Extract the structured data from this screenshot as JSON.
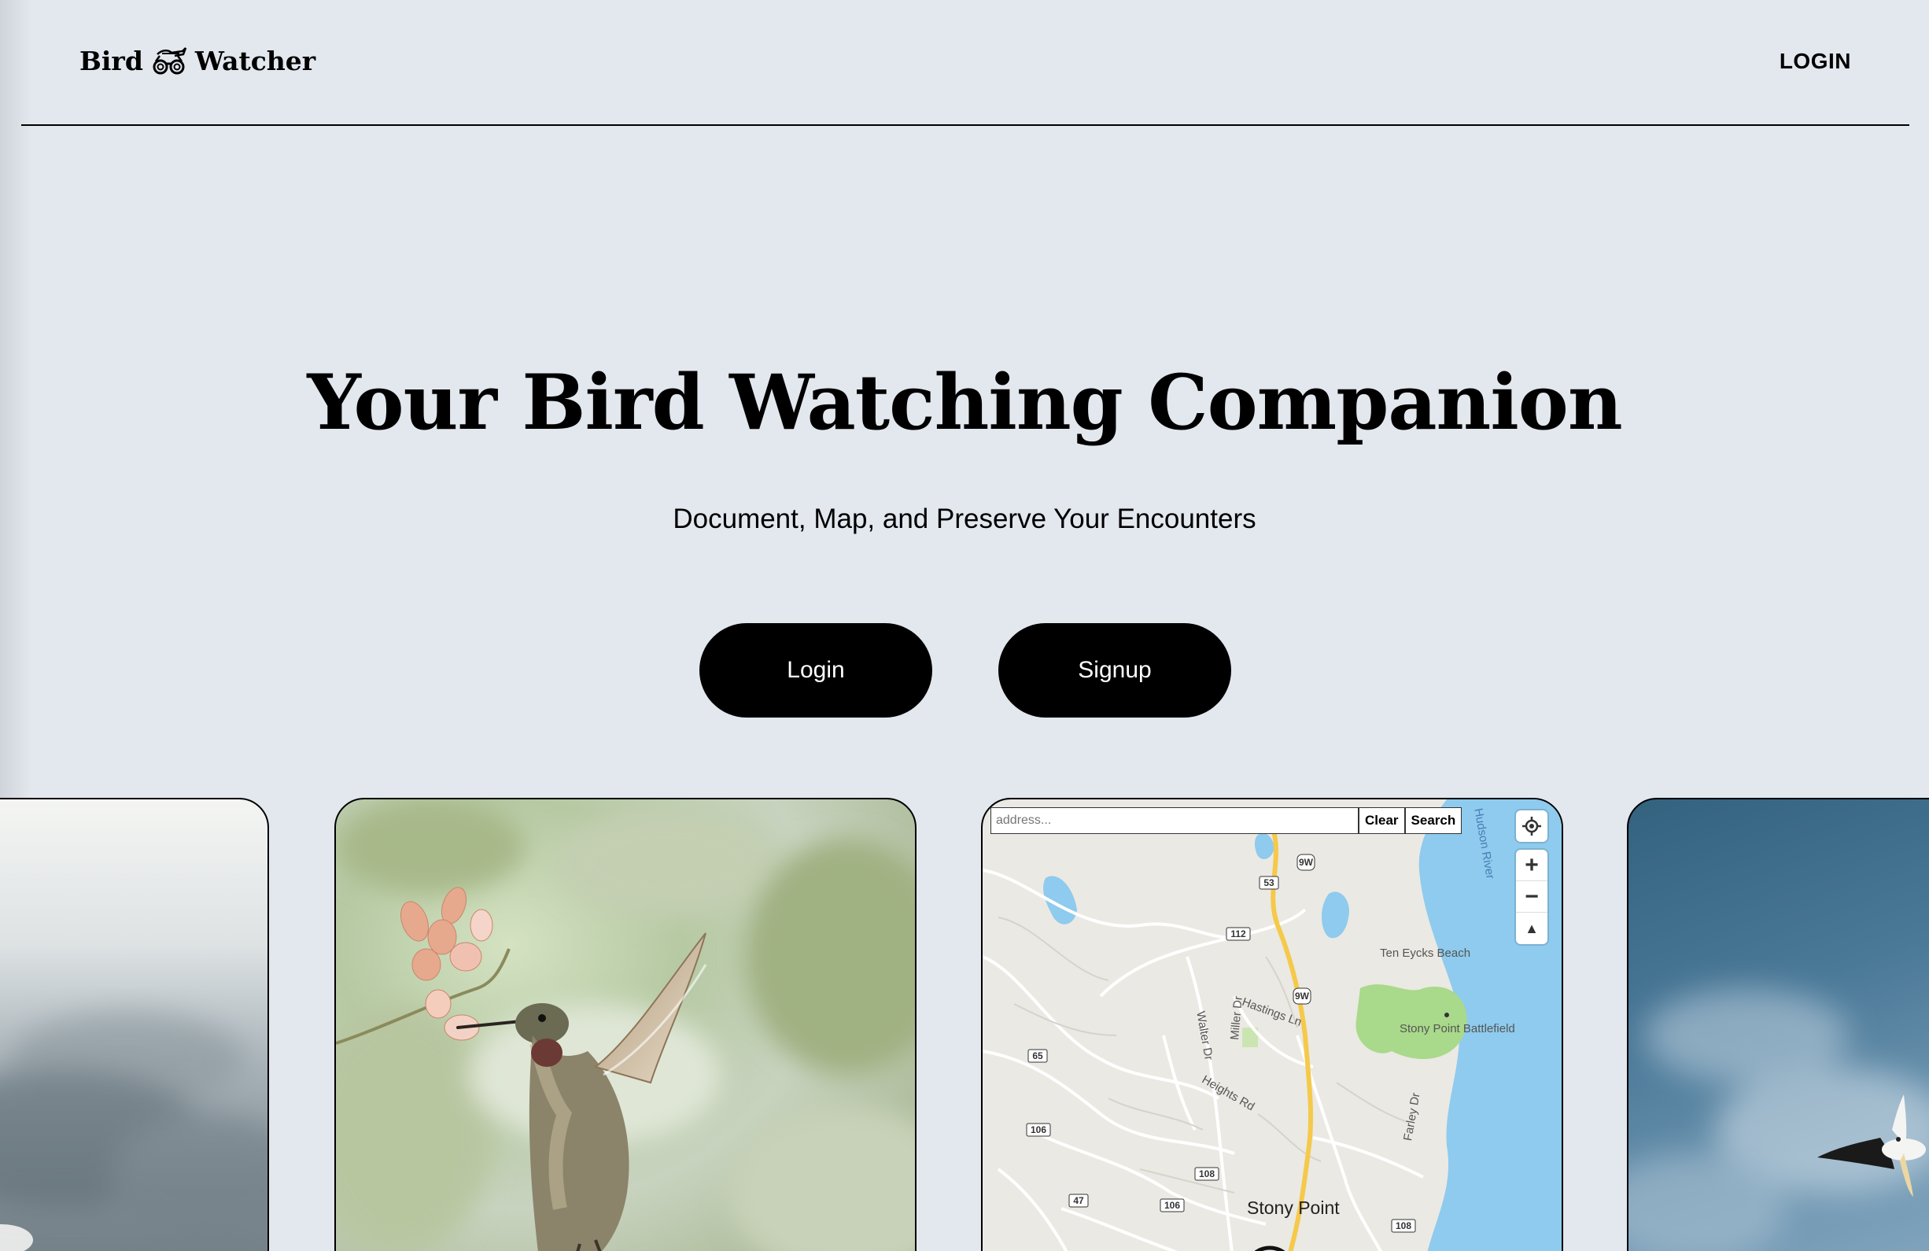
{
  "header": {
    "logo_left": "Bird",
    "logo_right": "Watcher",
    "nav_login": "LOGIN"
  },
  "hero": {
    "title": "Your Bird Watching Companion",
    "subtitle": "Document, Map, and Preserve Your Encounters",
    "login_button": "Login",
    "signup_button": "Signup"
  },
  "map_card": {
    "search_placeholder": "address...",
    "clear_button": "Clear",
    "search_button": "Search",
    "zoom_in": "+",
    "zoom_out": "−",
    "compass": "▲",
    "labels": {
      "river": "Hudson River",
      "beach": "Ten Eycks Beach",
      "battlefield": "Stony Point Battlefield",
      "hastings": "Hastings Ln",
      "walter": "Walter Dr",
      "miller": "Miller Dr",
      "heights": "Heights Rd",
      "farley": "Farley Dr",
      "city": "Stony Point"
    },
    "route_shields": [
      "9W",
      "9W",
      "53",
      "112",
      "65",
      "106",
      "108",
      "106",
      "47",
      "108"
    ]
  },
  "colors": {
    "background": "#e3e7ee",
    "button": "#000000",
    "water": "#8ecbee",
    "park": "#a9d98a",
    "highway": "#f5c94a"
  }
}
